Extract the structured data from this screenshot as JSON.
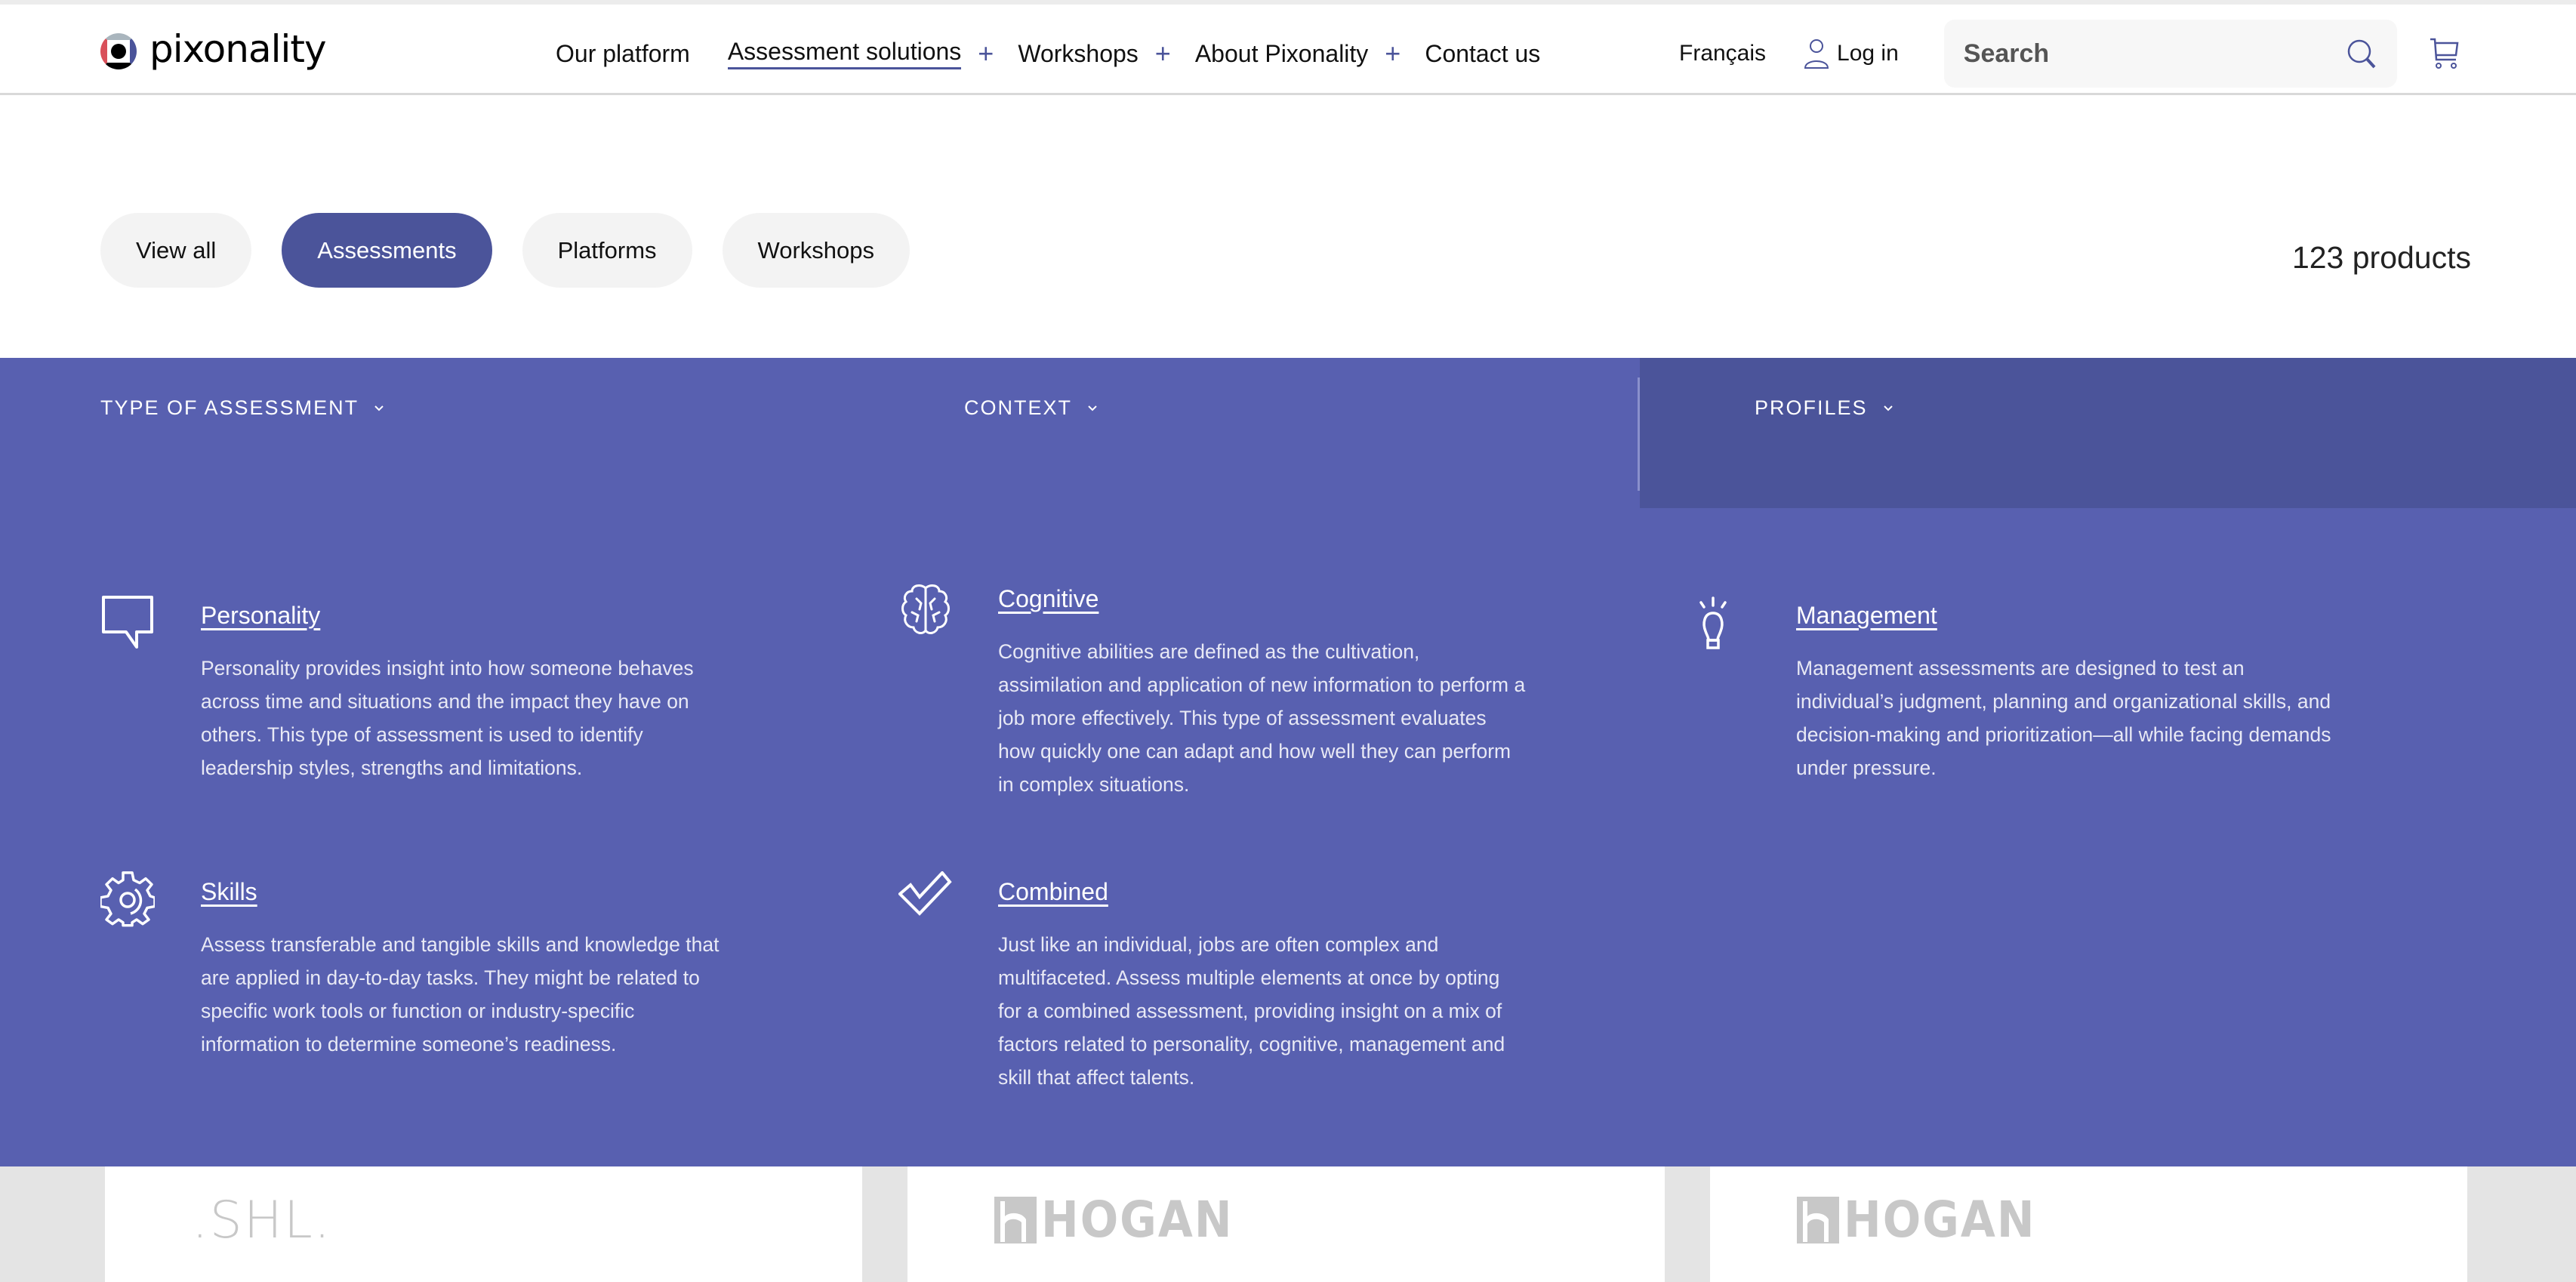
{
  "header": {
    "logo_text": "pixonality",
    "nav": [
      {
        "label": "Our platform",
        "expandable": false,
        "active": false
      },
      {
        "label": "Assessment solutions",
        "expandable": true,
        "active": true
      },
      {
        "label": "Workshops",
        "expandable": true,
        "active": false
      },
      {
        "label": "About Pixonality",
        "expandable": true,
        "active": false
      },
      {
        "label": "Contact us",
        "expandable": false,
        "active": false
      }
    ],
    "expand_symbol": "+",
    "language": "Français",
    "login": "Log in",
    "search_placeholder": "Search",
    "search_value": "",
    "icons": {
      "login": "user-icon",
      "search": "search-icon",
      "cart": "cart-icon"
    }
  },
  "filters_bar": {
    "pills": [
      {
        "label": "View all",
        "active": false
      },
      {
        "label": "Assessments",
        "active": true
      },
      {
        "label": "Platforms",
        "active": false
      },
      {
        "label": "Workshops",
        "active": false
      }
    ],
    "count": "123 products"
  },
  "dropdowns": [
    {
      "label": "TYPE OF ASSESSMENT",
      "icon": "chevron-down-icon"
    },
    {
      "label": "CONTEXT",
      "icon": "chevron-down-icon"
    },
    {
      "label": "PROFILES",
      "icon": "chevron-down-icon"
    }
  ],
  "categories": [
    {
      "title": "Personality",
      "icon": "speech-bubble-icon",
      "description": "Personality provides insight into how someone behaves across time and situations and the impact they have on others. This type of assessment is used to identify leadership styles, strengths and limitations."
    },
    {
      "title": "Cognitive",
      "icon": "brain-icon",
      "description": "Cognitive abilities are defined as the cultivation, assimilation and application of new information to perform a job more effectively. This type of assessment evaluates how quickly one can adapt and how well they can perform in complex situations."
    },
    {
      "title": "Management",
      "icon": "lightbulb-icon",
      "description": "Management assessments are designed to test an individual’s judgment, planning and organizational skills, and decision-making and prioritization—all while facing demands under pressure."
    },
    {
      "title": "Skills",
      "icon": "gear-icon",
      "description": "Assess transferable and tangible skills and knowledge that are applied in day-to-day tasks. They might be related to specific work tools or function or industry-specific information to determine someone’s readiness."
    },
    {
      "title": "Combined",
      "icon": "checkmark-icon",
      "description": "Just like an individual, jobs are often complex and multifaceted. Assess multiple elements at once by opting for a combined assessment, providing insight on a mix of factors related to personality, cognitive, management and skill that affect talents."
    }
  ],
  "products": [
    {
      "brand": ".SHL."
    },
    {
      "brand": "HOGAN"
    },
    {
      "brand": "HOGAN"
    }
  ],
  "colors": {
    "brand_purple": "#5860b0",
    "brand_purple_dark": "#4b549a",
    "pill_inactive": "#f3f3f3",
    "logo_red": "#d9505a",
    "logo_gray": "#a9b5bd"
  }
}
